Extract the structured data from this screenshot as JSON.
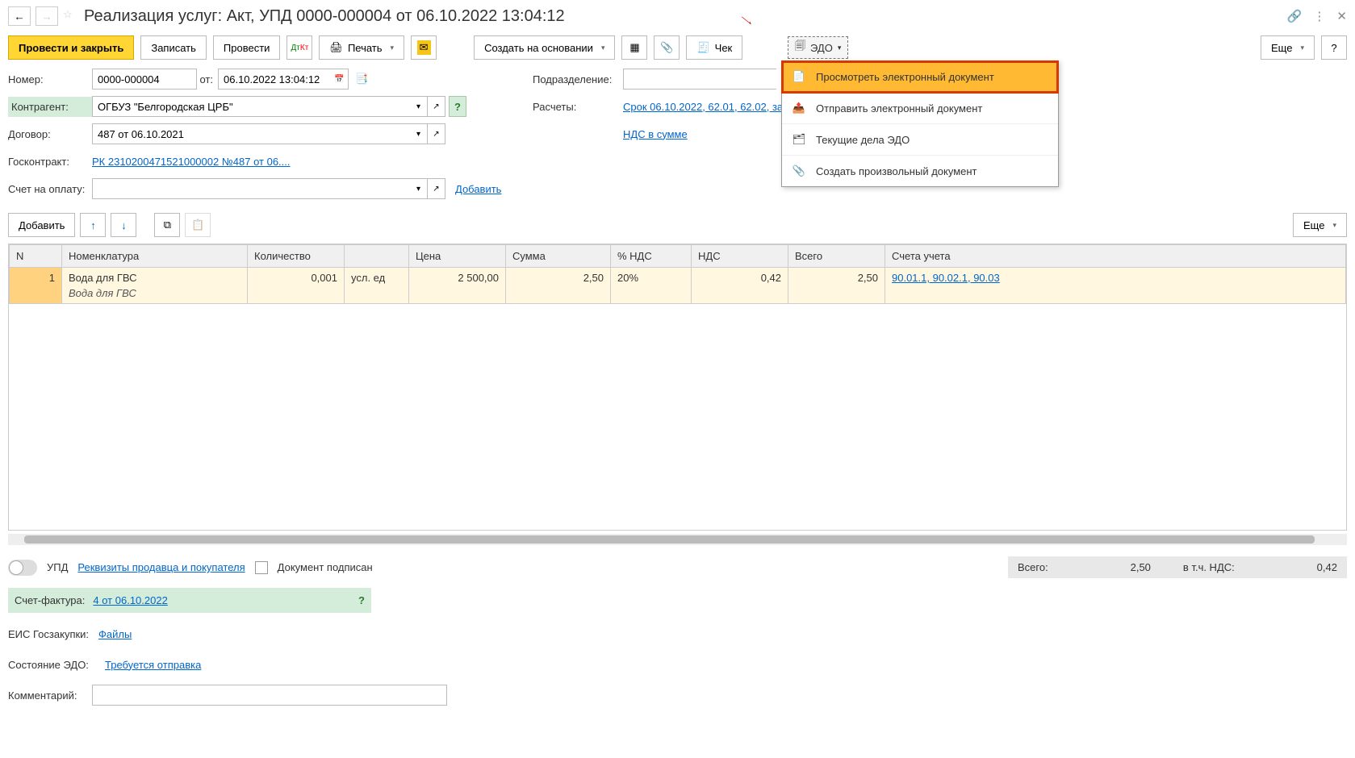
{
  "title": "Реализация услуг: Акт, УПД 0000-000004 от 06.10.2022 13:04:12",
  "toolbar": {
    "post_close": "Провести и закрыть",
    "write": "Записать",
    "post": "Провести",
    "print": "Печать",
    "create_based": "Создать на основании",
    "check": "Чек",
    "edo": "ЭДО",
    "more": "Еще"
  },
  "form": {
    "number_label": "Номер:",
    "number": "0000-000004",
    "date_label": "от:",
    "date": "06.10.2022 13:04:12",
    "contractor_label": "Контрагент:",
    "contractor": "ОГБУЗ \"Белгородская ЦРБ\"",
    "contract_label": "Договор:",
    "contract": "487 от 06.10.2021",
    "goscontract_label": "Госконтракт:",
    "goscontract": "РК 2310200471521000002 №487 от 06....",
    "invoice_pay_label": "Счет на оплату:",
    "add_link": "Добавить",
    "division_label": "Подразделение:",
    "calc_label": "Расчеты:",
    "calc_link": "Срок 06.10.2022, 62.01, 62.02, за",
    "vat_link": "НДС в сумме"
  },
  "table_toolbar": {
    "add": "Добавить",
    "more": "Еще"
  },
  "table": {
    "headers": [
      "N",
      "Номенклатура",
      "Количество",
      "",
      "Цена",
      "Сумма",
      "% НДС",
      "НДС",
      "Всего",
      "Счета учета"
    ],
    "rows": [
      {
        "n": "1",
        "nomenclature": "Вода для ГВС",
        "nomenclature_sub": "Вода для ГВС",
        "qty": "0,001",
        "unit": "усл. ед",
        "price": "2 500,00",
        "sum": "2,50",
        "vat_pct": "20%",
        "vat": "0,42",
        "total": "2,50",
        "accounts": "90.01.1, 90.02.1, 90.03"
      }
    ]
  },
  "footer": {
    "upd_label": "УПД",
    "req_link": "Реквизиты продавца и покупателя",
    "signed_label": "Документ подписан",
    "total_label": "Всего:",
    "total_val": "2,50",
    "incl_vat_label": "в т.ч. НДС:",
    "incl_vat_val": "0,42"
  },
  "invoice": {
    "label": "Счет-фактура:",
    "link": "4 от 06.10.2022"
  },
  "bottom": {
    "eis_label": "ЕИС Госзакупки:",
    "eis_link": "Файлы",
    "edo_state_label": "Состояние ЭДО:",
    "edo_state_link": "Требуется отправка",
    "comment_label": "Комментарий:"
  },
  "dropdown": {
    "view": "Просмотреть электронный документ",
    "send": "Отправить электронный документ",
    "current": "Текущие дела ЭДО",
    "create": "Создать произвольный документ"
  }
}
